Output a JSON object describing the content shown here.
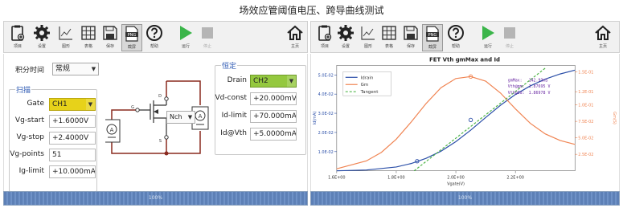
{
  "page_title": "场效应管阈值电压、跨导曲线测试",
  "toolbar": {
    "project": "项目",
    "settings": "设置",
    "chart": "图形",
    "table": "表格",
    "save": "保存",
    "screenshot": "截屏",
    "help": "帮助",
    "run": "运行",
    "stop": "停止",
    "home": "主页"
  },
  "left": {
    "integration_time_label": "积分时间",
    "integration_time_value": "常规",
    "sweep_title": "扫描",
    "gate_label": "Gate",
    "gate_value": "CH1",
    "vg_start_label": "Vg-start",
    "vg_start_value": "+1.6000V",
    "vg_stop_label": "Vg-stop",
    "vg_stop_value": "+2.4000V",
    "vg_points_label": "Vg-points",
    "vg_points_value": "51",
    "ig_limit_label": "Ig-limit",
    "ig_limit_value": "+10.000mA",
    "fixed_title": "恒定",
    "drain_label": "Drain",
    "drain_value": "CH2",
    "vd_const_label": "Vd-const",
    "vd_const_value": "+20.000mV",
    "id_limit_label": "Id-limit",
    "id_limit_value": "+70.000mA",
    "id_vth_label": "Id@Vth",
    "id_vth_value": "+5.0000mA",
    "circuit_type": "Nch",
    "pin_d": "D",
    "pin_g": "G",
    "pin_s": "S",
    "meter_symbol": "A",
    "status": "100%"
  },
  "right": {
    "status": "100%"
  },
  "colors": {
    "idrain": "#2b4fa8",
    "gm": "#f08452",
    "tangent": "#4fb548",
    "circuit_wire": "#8a2a1f",
    "axis_right": "#f08452",
    "axis_left": "#2b4fa8"
  },
  "chart_data": {
    "type": "line",
    "title": "FET Vth gmMax and Id",
    "xlabel": "Vgate(V)",
    "ylabel_left": "Id(mA)",
    "ylabel_right": "Gm(S)",
    "xlim": [
      1.6,
      2.4
    ],
    "ylim_left": [
      0,
      0.055
    ],
    "ylim_right": [
      0,
      0.16
    ],
    "x_ticks": [
      "1.6E+00",
      "1.8E+00",
      "2.0E+00",
      "2.2E+00"
    ],
    "y_left_ticks": [
      "1.0E-02",
      "2.0E-02",
      "3.0E-02",
      "4.0E-02",
      "5.0E-02"
    ],
    "y_right_ticks": [
      "2.5E-02",
      "5.0E-02",
      "7.5E-02",
      "1.0E-01",
      "1.2E-01",
      "1.5E-01"
    ],
    "legend": [
      "Idrain",
      "Gm",
      "Tangent"
    ],
    "annotations": [
      {
        "label": "gmMax:",
        "value": "142.93mS"
      },
      {
        "label": "Vth@gm:",
        "value": "1.87695 V"
      },
      {
        "label": "Vth@Id:",
        "value": "1.86978 V"
      }
    ],
    "series": [
      {
        "name": "Idrain",
        "axis": "left",
        "x": [
          1.6,
          1.7,
          1.8,
          1.85,
          1.9,
          1.95,
          2.0,
          2.05,
          2.1,
          2.15,
          2.2,
          2.25,
          2.3,
          2.35,
          2.4
        ],
        "y": [
          0.0,
          0.0004,
          0.002,
          0.0038,
          0.0065,
          0.0102,
          0.0152,
          0.0212,
          0.0278,
          0.0342,
          0.0398,
          0.0443,
          0.0478,
          0.0505,
          0.0525
        ]
      },
      {
        "name": "Gm",
        "axis": "right",
        "x": [
          1.6,
          1.7,
          1.75,
          1.8,
          1.85,
          1.9,
          1.95,
          2.0,
          2.05,
          2.1,
          2.15,
          2.2,
          2.25,
          2.3,
          2.35,
          2.4
        ],
        "y": [
          0.003,
          0.015,
          0.028,
          0.048,
          0.074,
          0.102,
          0.126,
          0.14,
          0.143,
          0.136,
          0.118,
          0.094,
          0.072,
          0.056,
          0.046,
          0.04
        ]
      },
      {
        "name": "Tangent",
        "axis": "left",
        "x": [
          1.86,
          2.3
        ],
        "y": [
          0.0,
          0.0535
        ]
      }
    ],
    "markers": [
      {
        "series": "Idrain",
        "x": 1.87,
        "y": 0.005
      },
      {
        "series": "Idrain",
        "x": 2.05,
        "y": 0.0265
      },
      {
        "series": "Gm",
        "x": 2.05,
        "y": 0.143
      }
    ]
  }
}
